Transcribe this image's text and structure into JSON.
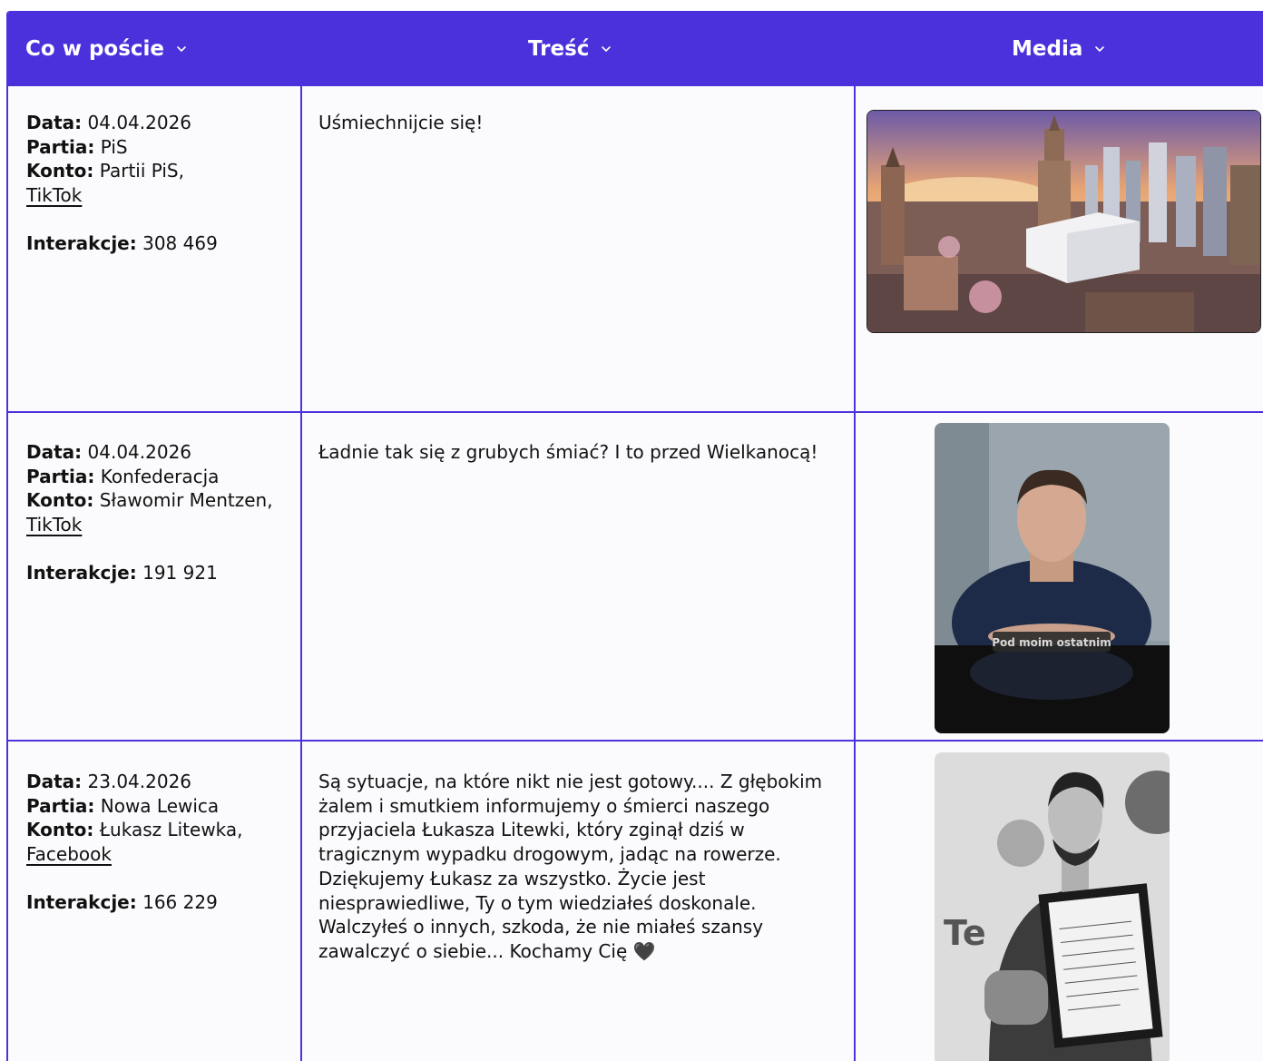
{
  "columns": [
    "Co w poście",
    "Treść",
    "Media"
  ],
  "labels": {
    "date": "Data:",
    "party": "Partia:",
    "account": "Konto:",
    "interactions": "Interakcje:"
  },
  "rows": [
    {
      "date": "04.04.2026",
      "party": "PiS",
      "account": "Partii PiS,",
      "platform": "TikTok",
      "interactions": "308 469",
      "text": "Uśmiechnijcie się!",
      "media_overlay": ""
    },
    {
      "date": "04.04.2026",
      "party": "Konfederacja",
      "account": "Sławomir Mentzen,",
      "platform": "TikTok",
      "interactions": "191 921",
      "text": "Ładnie tak się z grubych śmiać? I to przed Wielkanocą!",
      "media_overlay": "Pod moim ostatnim"
    },
    {
      "date": "23.04.2026",
      "party": "Nowa Lewica",
      "account": "Łukasz Litewka,",
      "platform": "Facebook",
      "interactions": "166 229",
      "text": "Są sytuacje, na które nikt nie jest gotowy.... Z głębokim żalem i smutkiem informujemy o śmierci naszego przyjaciela Łukasza Litewki, który zginął dziś w tragicznym wypadku drogowym, jadąc na rowerze. Dziękujemy Łukasz za wszystko. Życie jest niesprawiedliwe, Ty o tym wiedziałeś doskonale. Walczyłeś o innych, szkoda, że nie miałeś szansy zawalczyć o siebie... Kochamy Cię 🖤",
      "media_overlay": "Te"
    }
  ],
  "colors": {
    "accent": "#4a31dc",
    "background": "#fbfbfd"
  }
}
